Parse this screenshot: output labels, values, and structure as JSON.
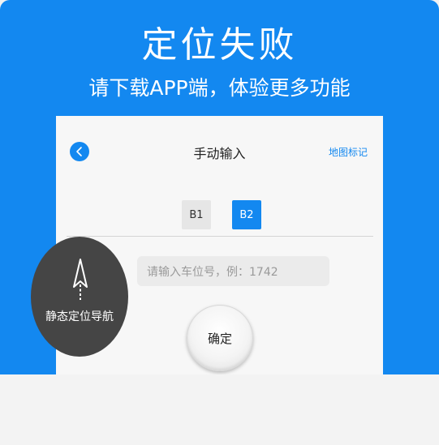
{
  "promo": {
    "headline": "定位失败",
    "subhead": "请下载APP端，体验更多功能"
  },
  "screen": {
    "nav": {
      "back_icon": "chevron-left-icon",
      "title": "手动输入",
      "map_link": "地图标记"
    },
    "floors": [
      {
        "label": "B1",
        "selected": false
      },
      {
        "label": "B2",
        "selected": true
      }
    ],
    "spot_input": {
      "placeholder": "请输入车位号，例：1742",
      "value": ""
    },
    "confirm_label": "确定"
  },
  "static_nav": {
    "icon": "navigation-arrow-icon",
    "label": "静态定位导航"
  },
  "colors": {
    "brand_blue": "#1388f0",
    "dark_circle": "#454545"
  }
}
